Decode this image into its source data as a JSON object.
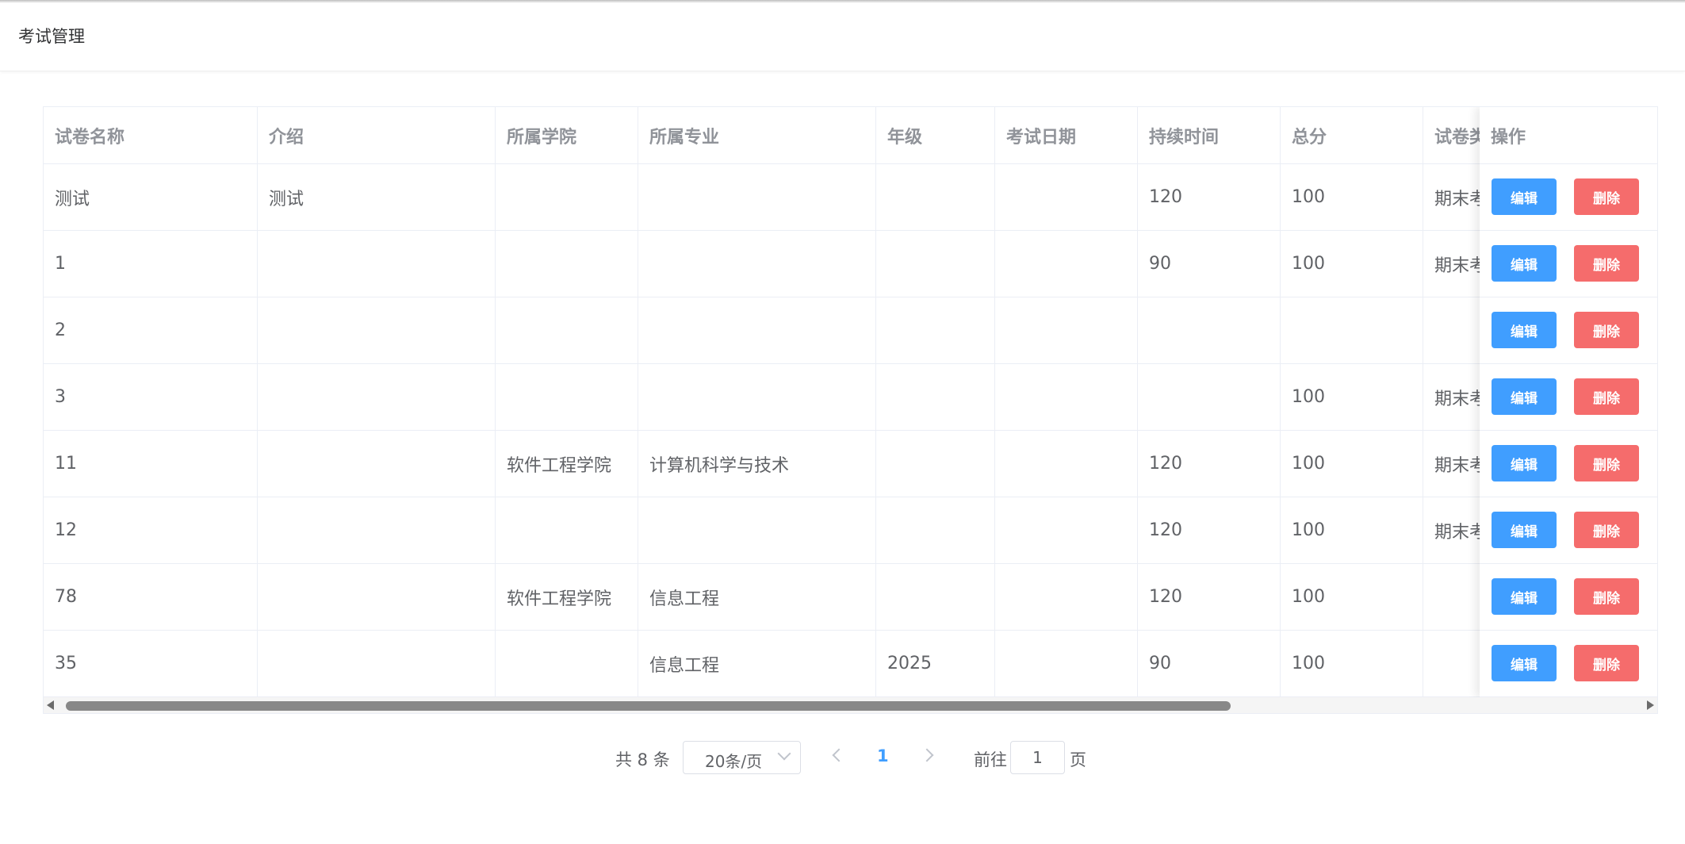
{
  "header": {
    "title": "考试管理"
  },
  "table": {
    "columns": [
      "试卷名称",
      "介绍",
      "所属学院",
      "所属专业",
      "年级",
      "考试日期",
      "持续时间",
      "总分",
      "试卷类"
    ],
    "action_header": "操作",
    "rows": [
      [
        "测试",
        "测试",
        "",
        "",
        "",
        "",
        "120",
        "100",
        "期末考"
      ],
      [
        "1",
        "",
        "",
        "",
        "",
        "",
        "90",
        "100",
        "期末考"
      ],
      [
        "2",
        "",
        "",
        "",
        "",
        "",
        "",
        "",
        ""
      ],
      [
        "3",
        "",
        "",
        "",
        "",
        "",
        "",
        "100",
        "期末考"
      ],
      [
        "11",
        "",
        "软件工程学院",
        "计算机科学与技术",
        "",
        "",
        "120",
        "100",
        "期末考"
      ],
      [
        "12",
        "",
        "",
        "",
        "",
        "",
        "120",
        "100",
        "期末考"
      ],
      [
        "78",
        "",
        "软件工程学院",
        "信息工程",
        "",
        "",
        "120",
        "100",
        ""
      ],
      [
        "35",
        "",
        "",
        "信息工程",
        "2025",
        "",
        "90",
        "100",
        ""
      ]
    ],
    "edit_label": "编辑",
    "delete_label": "删除"
  },
  "scrollbar": {
    "visible_fraction": 0.53
  },
  "pagination": {
    "total_text": "共 8 条",
    "page_size": "20条/页",
    "current_page": "1",
    "goto_label": "前往",
    "goto_value": "1",
    "goto_suffix": "页"
  },
  "colors": {
    "primary": "#409eff",
    "danger": "#f56c6c",
    "border": "#ebeef5",
    "header_text": "#909399"
  }
}
